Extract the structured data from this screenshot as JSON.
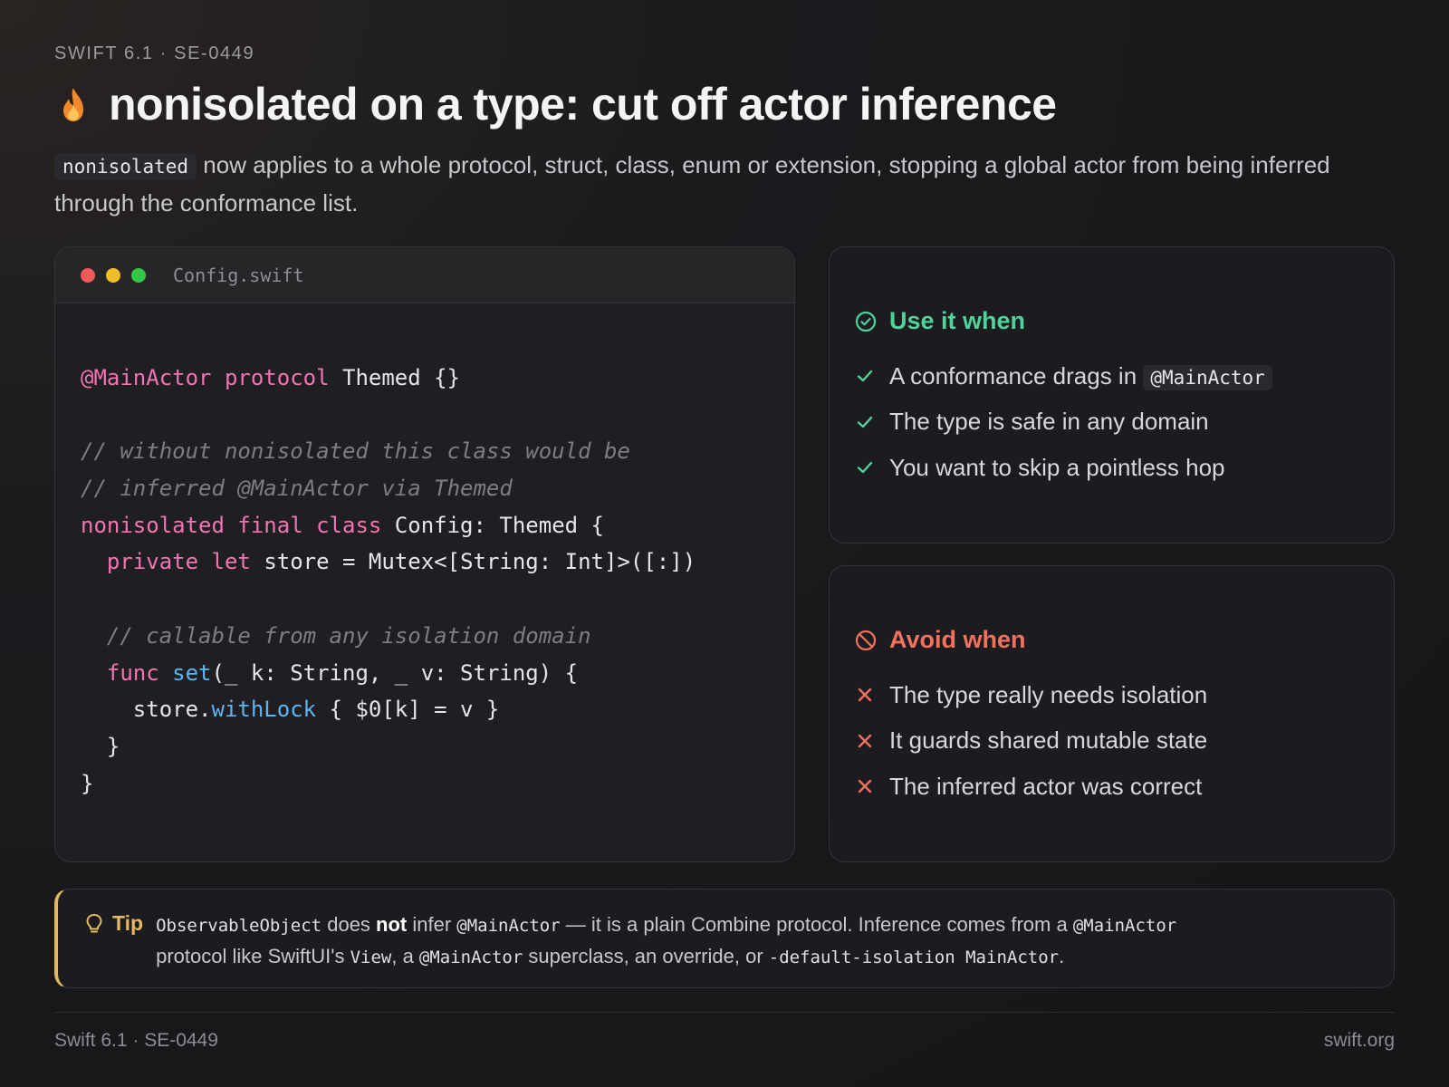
{
  "eyebrow": "SWIFT 6.1 · SE-0449",
  "title": "nonisolated on a type: cut off actor inference",
  "title_icon": "flame-icon",
  "lede": {
    "code": "nonisolated",
    "text_1": " now applies to a whole protocol, struct, class, enum or extension, stopping a global actor from being inferred through the conformance list."
  },
  "code_window": {
    "filename": "Config.swift",
    "traffic_lights": [
      "#f05a5a",
      "#f2bd2b",
      "#33c748"
    ],
    "lines": [
      [
        {
          "t": "@MainActor",
          "c": "attr"
        },
        {
          "t": " "
        },
        {
          "t": "protocol",
          "c": "kw"
        },
        {
          "t": " Themed {}"
        }
      ],
      [],
      [
        {
          "t": "// without nonisolated this class would be",
          "c": "cm"
        }
      ],
      [
        {
          "t": "// inferred @MainActor via Themed",
          "c": "cm"
        }
      ],
      [
        {
          "t": "nonisolated",
          "c": "kw"
        },
        {
          "t": " "
        },
        {
          "t": "final",
          "c": "kw"
        },
        {
          "t": " "
        },
        {
          "t": "class",
          "c": "kw"
        },
        {
          "t": " Config: Themed {"
        }
      ],
      [
        {
          "t": "  "
        },
        {
          "t": "private",
          "c": "kw"
        },
        {
          "t": " "
        },
        {
          "t": "let",
          "c": "kw"
        },
        {
          "t": " store = Mutex<[String: Int]>([:])"
        }
      ],
      [],
      [
        {
          "t": "  "
        },
        {
          "t": "// callable from any isolation domain",
          "c": "cm"
        }
      ],
      [
        {
          "t": "  "
        },
        {
          "t": "func",
          "c": "kw"
        },
        {
          "t": " "
        },
        {
          "t": "set",
          "c": "fn"
        },
        {
          "t": "(_ k: String, _ v: String) {"
        }
      ],
      [
        {
          "t": "    store."
        },
        {
          "t": "withLock",
          "c": "fn"
        },
        {
          "t": " { $0[k] = v }"
        }
      ],
      [
        {
          "t": "  }"
        }
      ],
      [
        {
          "t": "}"
        }
      ]
    ]
  },
  "use_card": {
    "heading": "Use it when",
    "icon": "check-circle-icon",
    "color": "#4fd39a",
    "items": [
      {
        "text": "A conformance drags in ",
        "code": "@MainActor"
      },
      {
        "text": "The type is safe in any domain"
      },
      {
        "text": "You want to skip a pointless hop"
      }
    ]
  },
  "avoid_card": {
    "heading": "Avoid when",
    "icon": "prohibited-icon",
    "color": "#f2715f",
    "items": [
      {
        "text": "The type really needs isolation"
      },
      {
        "text": "It guards shared mutable state"
      },
      {
        "text": "The inferred actor was correct"
      }
    ]
  },
  "tip": {
    "label": "Tip",
    "icon": "lightbulb-icon",
    "accent": "#e2b860",
    "line1": [
      {
        "t": "ObservableObject",
        "code": true
      },
      {
        "t": " does "
      },
      {
        "t": "not",
        "bold": true
      },
      {
        "t": " infer "
      },
      {
        "t": "@MainActor",
        "code": true
      },
      {
        "t": " — it is a plain Combine protocol. Inference comes from a "
      },
      {
        "t": "@MainActor",
        "code": true
      }
    ],
    "line2": [
      {
        "t": "protocol like SwiftUI's "
      },
      {
        "t": "View",
        "code": true
      },
      {
        "t": ", a "
      },
      {
        "t": "@MainActor",
        "code": true
      },
      {
        "t": " superclass, an override, or "
      },
      {
        "t": "-default-isolation MainActor",
        "code": true
      },
      {
        "t": "."
      }
    ]
  },
  "footer": {
    "left": "Swift 6.1 · SE-0449",
    "right": "swift.org"
  }
}
